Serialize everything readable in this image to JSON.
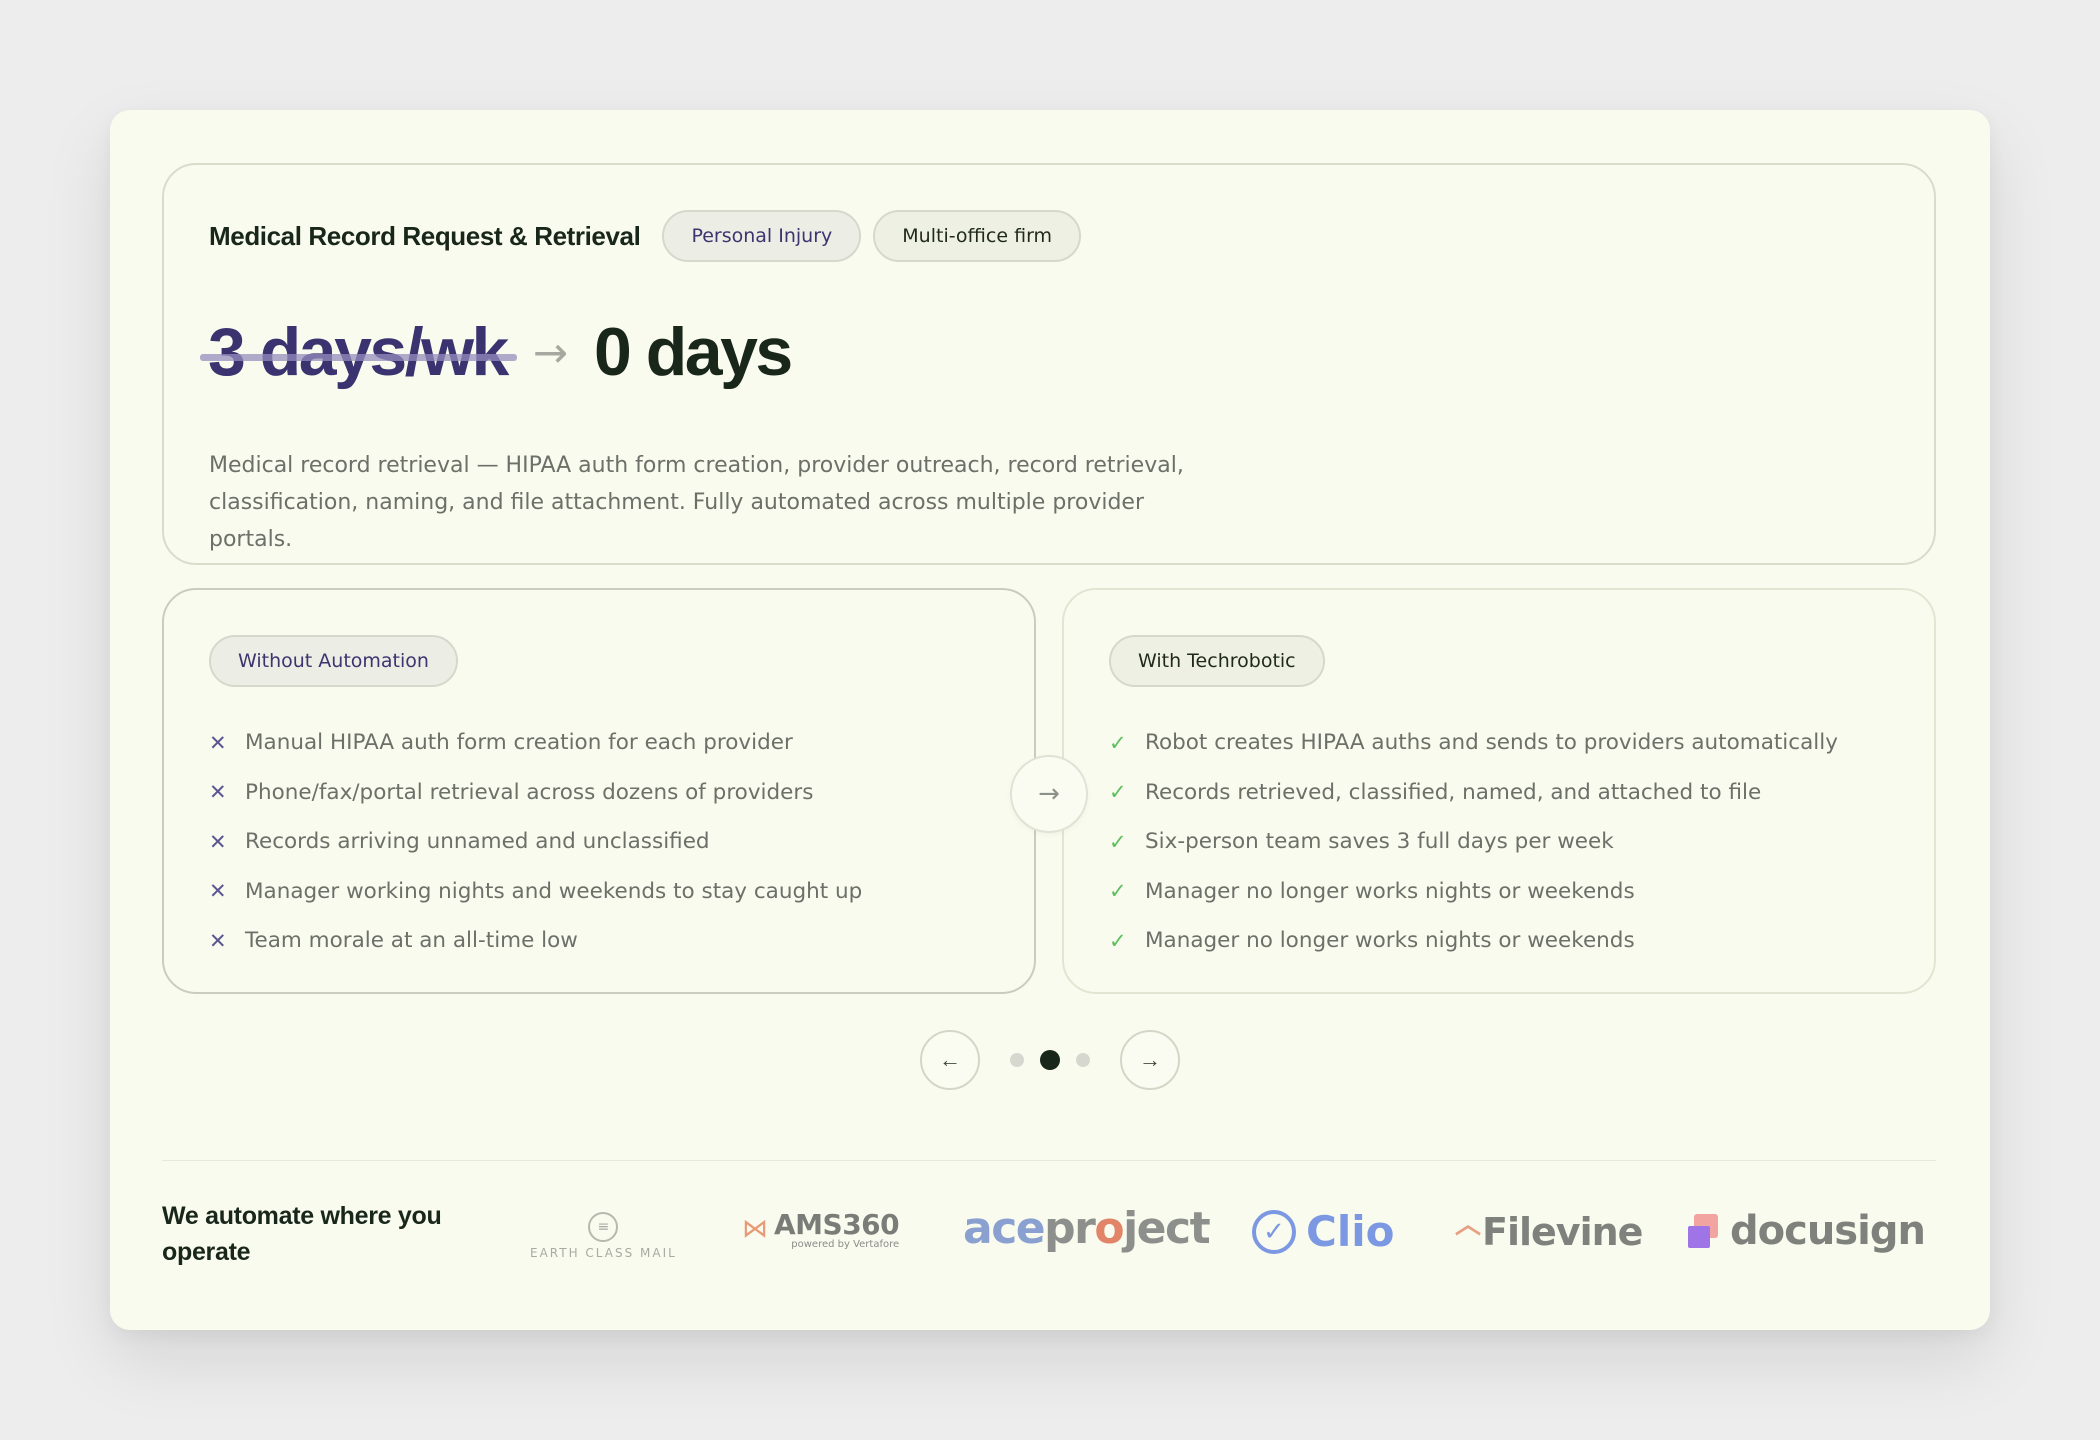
{
  "hero": {
    "title": "Medical Record Request & Retrieval",
    "tags": [
      "Personal Injury",
      "Multi-office firm"
    ],
    "metric_before": "3 days/wk",
    "metric_arrow": "→",
    "metric_after": "0 days",
    "description": "Medical record retrieval — HIPAA auth form creation, provider outreach, record retrieval, classification, naming, and file attachment. Fully automated across multiple provider portals."
  },
  "without": {
    "label": "Without Automation",
    "icon": "x-icon",
    "items": [
      "Manual HIPAA auth form creation for each provider",
      "Phone/fax/portal retrieval across dozens of providers",
      "Records arriving unnamed and unclassified",
      "Manager working nights and weekends to stay caught up",
      "Team morale at an all-time low"
    ]
  },
  "with": {
    "label": "With Techrobotic",
    "icon": "check-icon",
    "items": [
      "Robot creates HIPAA auths and sends to providers automatically",
      "Records retrieved, classified, named, and attached to file",
      "Six-person team saves 3 full days per week",
      "Manager no longer works nights or weekends",
      "Manager no longer works nights or weekends"
    ]
  },
  "center_arrow": "→",
  "pager": {
    "prev": "←",
    "next": "→",
    "total": 3,
    "active": 2
  },
  "footer": {
    "headline": "We automate where you operate",
    "logos": {
      "ecm": "EARTH CLASS MAIL",
      "ams": "AMS360",
      "ams_sub": "powered by Vertafore",
      "ace_a": "ace",
      "ace_b1": "pr",
      "ace_o": "o",
      "ace_b2": "ject",
      "clio": "Clio",
      "filevine": "Filevine",
      "docusign": "docusign"
    }
  },
  "colors": {
    "panel": "#f9fbee",
    "accent_purple": "#3a3370",
    "dark_green": "#19261a",
    "check_green": "#5cc05f"
  }
}
